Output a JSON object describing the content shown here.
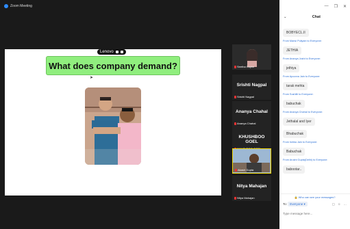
{
  "window": {
    "title": "Zoom Meeting"
  },
  "share": {
    "banner_text": "What does company demand?",
    "lenovo_label": "Lenovo"
  },
  "gallery": [
    {
      "type": "photo",
      "label": "Seetha Gupta"
    },
    {
      "type": "name",
      "name": "Srishti Nagpal",
      "label": "Srishti Nagpal"
    },
    {
      "type": "name",
      "name": "Ananya Chahal",
      "label": "Ananya Chahal"
    },
    {
      "type": "name",
      "name": "KHUSHBOO GOEL",
      "label": "KHUSHBOO GOEL"
    },
    {
      "type": "video",
      "label": "Akash Gupta"
    },
    {
      "type": "name",
      "name": "Nitya Mahajan",
      "label": "Nitya Mahajan"
    }
  ],
  "chat": {
    "title": "Chat",
    "collapse_icon": "chevron-down-icon",
    "messages": [
      {
        "from": "",
        "text": "BOBYECL.II"
      },
      {
        "from": "From Mansi Puliyani to Everyone:",
        "text": "JETHIA"
      },
      {
        "from": "From Ananya Joshi to Everyone:",
        "text": "jethiya"
      },
      {
        "from": "From Apoorva Jain to Everyone:",
        "text": "tarak mehta"
      },
      {
        "from": "From Sushilti to Everyone:",
        "text": "babuchak"
      },
      {
        "from": "From Ananya Chahal to Everyone:",
        "text": "Jethalal and Iyer"
      },
      {
        "from": "",
        "text": "Bhabuchak"
      },
      {
        "from": "From Ishika Jain to Everyone:",
        "text": "Babuchak"
      },
      {
        "from": "From Arushi Gupta(Delhi) to Everyone:",
        "text": "babootar.."
      }
    ],
    "who_can_see": "Who can see your messages?",
    "to_label": "To:",
    "to_value": "Everyone",
    "placeholder": "Type message here..."
  }
}
